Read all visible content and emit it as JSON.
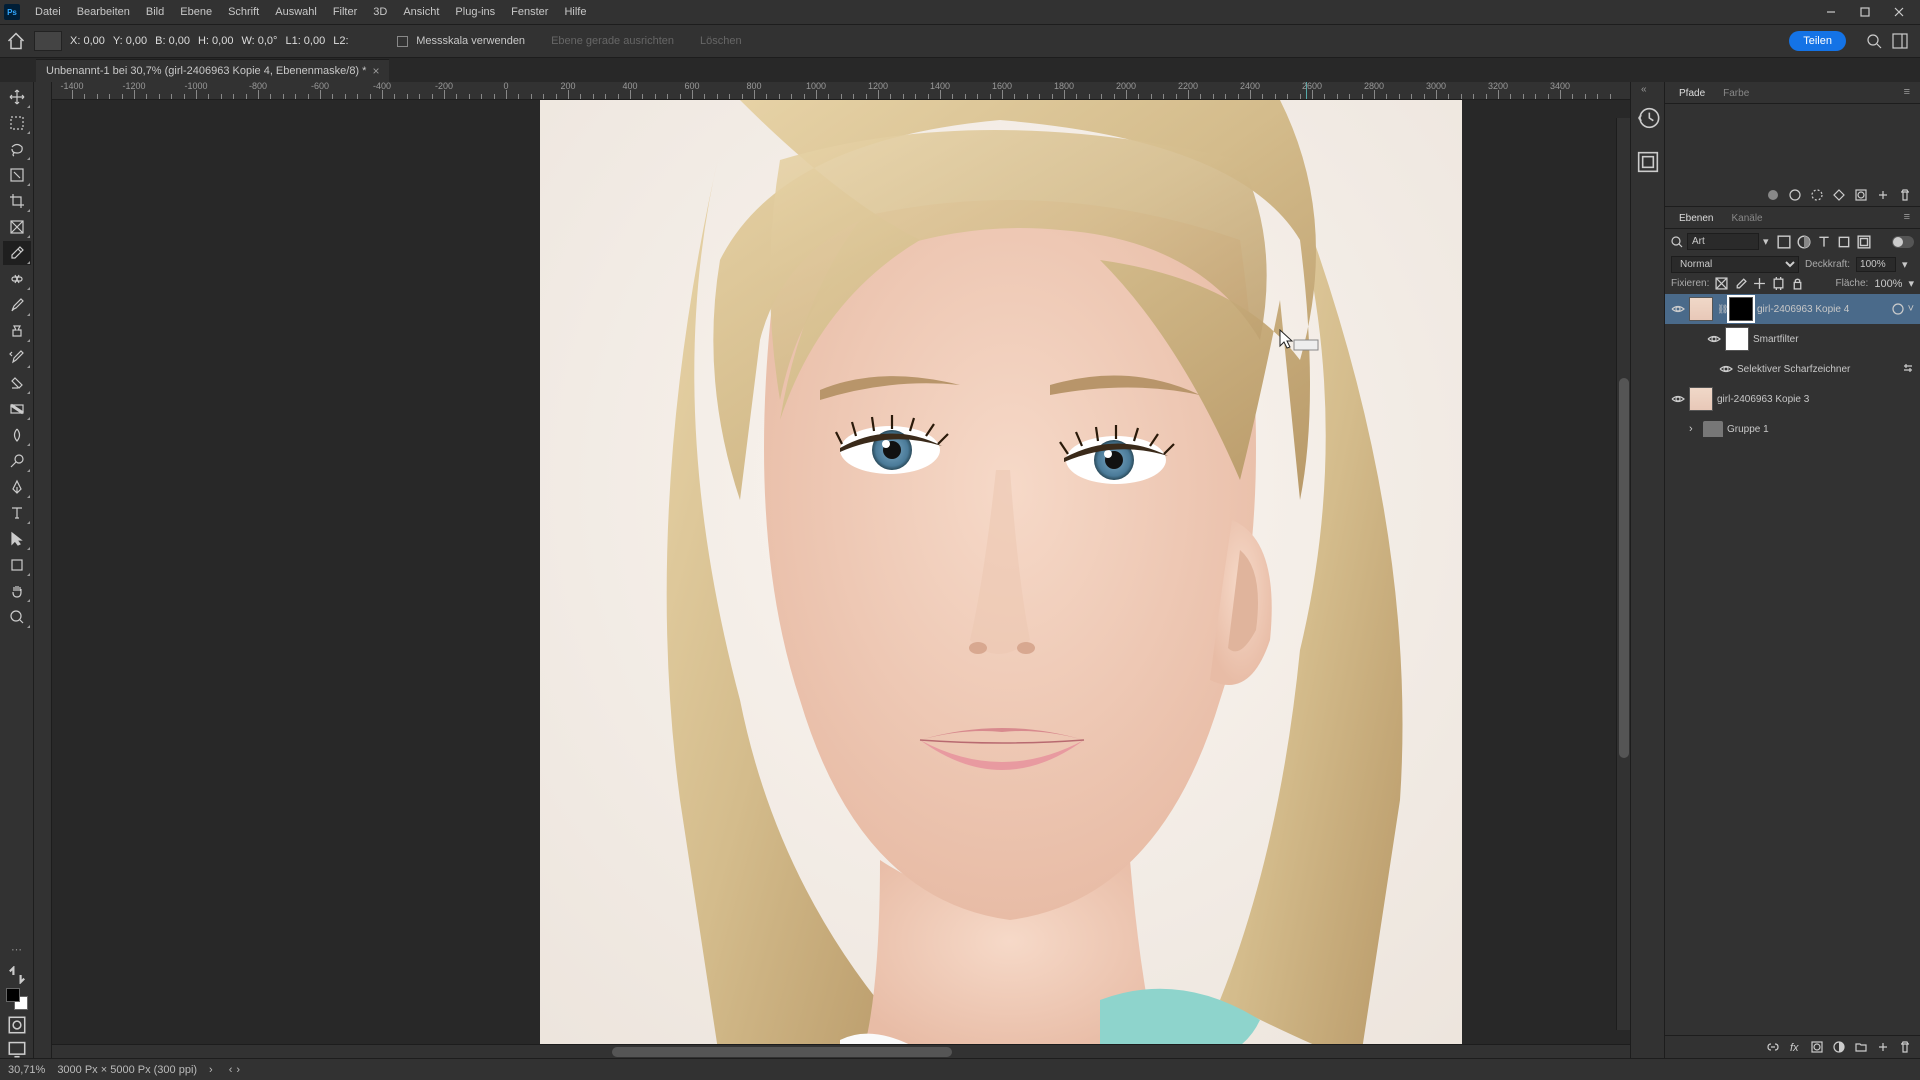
{
  "menu": [
    "Datei",
    "Bearbeiten",
    "Bild",
    "Ebene",
    "Schrift",
    "Auswahl",
    "Filter",
    "3D",
    "Ansicht",
    "Plug-ins",
    "Fenster",
    "Hilfe"
  ],
  "options": {
    "x": "X: 0,00",
    "y": "Y: 0,00",
    "b": "B: 0,00",
    "h": "H: 0,00",
    "w": "W: 0,0°",
    "l1": "L1: 0,00",
    "l2": "L2:",
    "check_label": "Messskala verwenden",
    "align": "Ebene gerade ausrichten",
    "clear": "Löschen",
    "share": "Teilen"
  },
  "doc_tab": "Unbenannt-1 bei 30,7% (girl-2406963 Kopie 4, Ebenenmaske/8) *",
  "ruler_ticks": [
    "-1400",
    "-1200",
    "-1000",
    "-800",
    "-600",
    "-400",
    "-200",
    "0",
    "200",
    "400",
    "600",
    "800",
    "1000",
    "1200",
    "1400",
    "1600",
    "1800",
    "2000",
    "2200",
    "2400",
    "2600",
    "2800",
    "3000",
    "3200",
    "3400"
  ],
  "rpanel": {
    "pfade": "Pfade",
    "farbe": "Farbe",
    "ebenen": "Ebenen",
    "kanale": "Kanäle",
    "search_placeholder": "Art",
    "blend_mode": "Normal",
    "opacity_label": "Deckkraft:",
    "opacity_val": "100%",
    "lock_label": "Fixieren:",
    "fill_label": "Fläche:",
    "fill_val": "100%"
  },
  "layers": {
    "l1": "girl-2406963 Kopie 4",
    "smartfilter": "Smartfilter",
    "sharpen": "Selektiver Scharfzeichner",
    "l3": "girl-2406963 Kopie 3",
    "grp": "Gruppe 1"
  },
  "status": {
    "zoom": "30,71%",
    "dims": "3000 Px × 5000 Px (300 ppi)"
  }
}
